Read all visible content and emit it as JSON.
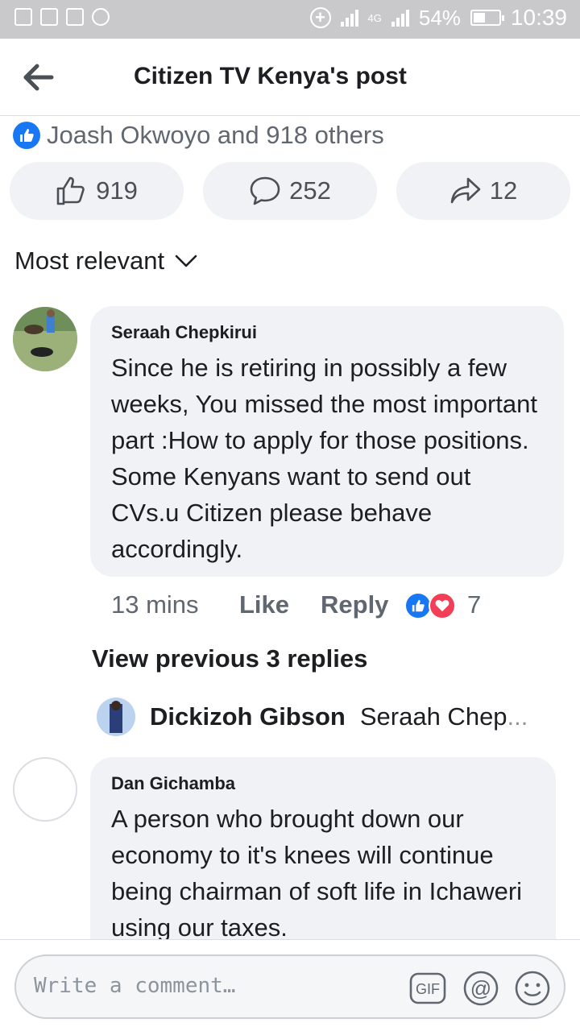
{
  "status_bar": {
    "sim_label": "4G",
    "battery": "54%",
    "time": "10:39"
  },
  "header": {
    "title": "Citizen TV Kenya's post"
  },
  "reactions": {
    "summary": "Joash Okwoyo and 918 others"
  },
  "actions": {
    "like_count": "919",
    "comment_count": "252",
    "share_count": "12"
  },
  "sort": {
    "label": "Most relevant"
  },
  "comments": [
    {
      "author": "Seraah Chepkirui",
      "text": "Since he is retiring in possibly a few weeks, You missed the most important part :How to apply for those positions. Some Kenyans want to send out CVs.u Citizen please behave accordingly.",
      "time": "13 mins",
      "like_label": "Like",
      "reply_label": "Reply",
      "reaction_count": "7"
    },
    {
      "author": "Dan Gichamba",
      "text": "A person who brought down our economy to it's knees will continue being chairman of soft life in Ichaweri using our taxes."
    }
  ],
  "replies": {
    "view_previous": "View previous 3 replies",
    "latest_author": "Dickizoh Gibson",
    "latest_snippet": "Seraah Chep",
    "ellipsis": "..."
  },
  "composer": {
    "placeholder": "Write a comment…"
  },
  "colors": {
    "accent_blue": "#1877f2",
    "love_red": "#f33e58",
    "bubble_bg": "#f0f2f5"
  }
}
